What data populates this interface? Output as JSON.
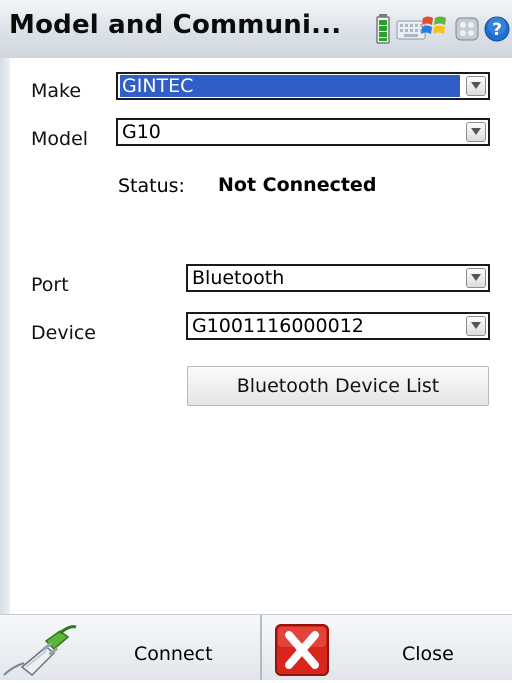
{
  "window": {
    "title": "Model and Communi...",
    "tray_icons": [
      "battery-icon",
      "keyboard-icon",
      "windows-flag-icon",
      "apps-icon",
      "help-icon"
    ]
  },
  "form": {
    "make": {
      "label": "Make",
      "value": "GINTEC"
    },
    "model": {
      "label": "Model",
      "value": "G10"
    },
    "status": {
      "label": "Status:",
      "value": "Not Connected"
    },
    "port": {
      "label": "Port",
      "value": "Bluetooth"
    },
    "device": {
      "label": "Device",
      "value": "G1001116000012"
    },
    "bluetooth_list_button": "Bluetooth Device List"
  },
  "footer": {
    "connect_label": "Connect",
    "close_label": "Close",
    "connect_icon": "plug-icon",
    "close_icon": "red-x-icon"
  },
  "colors": {
    "selection": "#2f5ec6",
    "close_red": "#d8261c"
  }
}
